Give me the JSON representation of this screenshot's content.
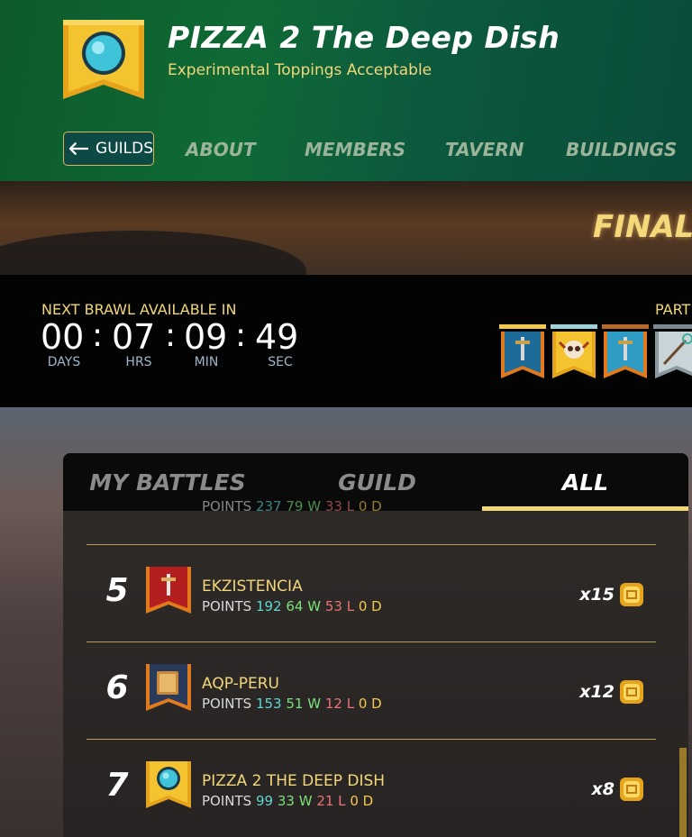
{
  "header": {
    "guild_name": "PIZZA 2 The Deep Dish",
    "motto": "Experimental Toppings Acceptable",
    "back_button_label": "GUILDS",
    "tabs": [
      "ABOUT",
      "MEMBERS",
      "TAVERN",
      "BUILDINGS"
    ]
  },
  "event_banner": {
    "title": "FINAL"
  },
  "brawl": {
    "label": "NEXT BRAWL AVAILABLE IN",
    "timer": {
      "days": "00",
      "hrs": "07",
      "min": "09",
      "sec": "49"
    },
    "units": {
      "days": "DAYS",
      "hrs": "HRS",
      "min": "MIN",
      "sec": "SEC"
    },
    "participants_label": "PART",
    "participant_icons": [
      "sword-banner-icon",
      "skull-banner-icon",
      "sword-banner-icon",
      "staff-banner-icon"
    ]
  },
  "battles": {
    "tabs": [
      "MY BATTLES",
      "GUILD",
      "ALL"
    ],
    "active_tab": "ALL",
    "partial_row": {
      "label": "POINTS",
      "points": "237",
      "wins": "79 W",
      "losses": "33 L",
      "draws": "0 D"
    },
    "rows": [
      {
        "rank": "5",
        "name": "EKZISTENCIA",
        "stats_label": "POINTS",
        "points": "192",
        "wins": "64 W",
        "losses": "53 L",
        "draws": "0 D",
        "multiplier": "x15",
        "banner": "sword-banner-icon"
      },
      {
        "rank": "6",
        "name": "AQP-PERU",
        "stats_label": "POINTS",
        "points": "153",
        "wins": "51 W",
        "losses": "12 L",
        "draws": "0 D",
        "multiplier": "x12",
        "banner": "book-banner-icon"
      },
      {
        "rank": "7",
        "name": "PIZZA 2 THE DEEP DISH",
        "stats_label": "POINTS",
        "points": "99",
        "wins": "33 W",
        "losses": "21 L",
        "draws": "0 D",
        "multiplier": "x8",
        "banner": "orb-banner-icon"
      }
    ]
  },
  "colors": {
    "accent": "#f2d77a",
    "header_green": "#0f6a35",
    "points": "#5fd6d0",
    "wins": "#7be07b",
    "losses": "#e87474",
    "draws": "#f2c94c"
  }
}
